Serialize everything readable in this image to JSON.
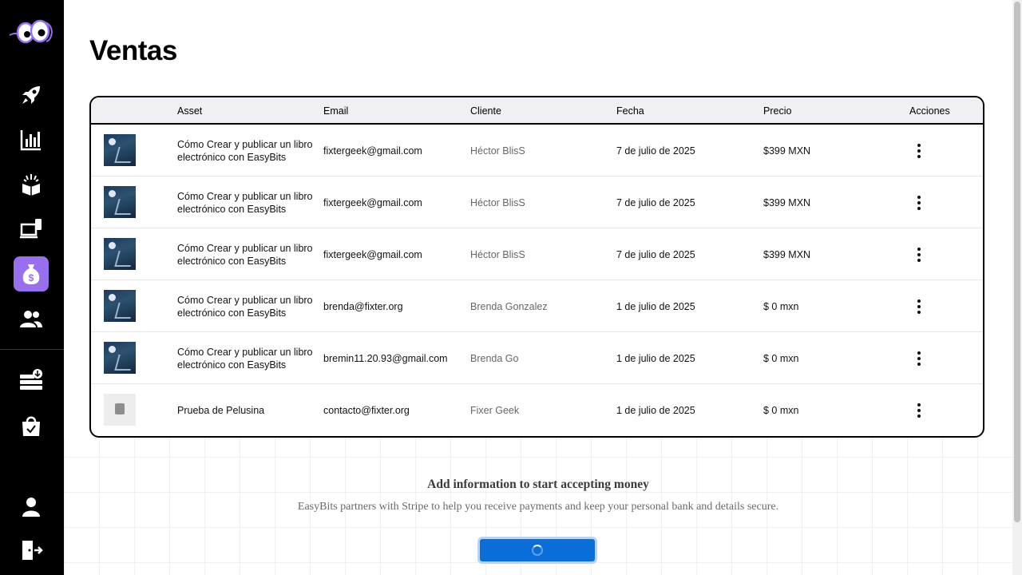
{
  "page": {
    "title": "Ventas"
  },
  "sidebar": {
    "active": "sales",
    "accent_color": "#9870ED",
    "items": [
      {
        "name": "rocket-icon"
      },
      {
        "name": "stats-chart-icon"
      },
      {
        "name": "gift-box-icon"
      },
      {
        "name": "laptop-device-icon"
      },
      {
        "name": "money-bag-icon"
      },
      {
        "name": "users-icon"
      },
      {
        "name": "database-download-icon"
      },
      {
        "name": "shopping-bag-icon"
      },
      {
        "name": "user-profile-icon"
      },
      {
        "name": "logout-icon"
      }
    ]
  },
  "table": {
    "headers": {
      "asset": "Asset",
      "email": "Email",
      "client": "Cliente",
      "date": "Fecha",
      "price": "Precio",
      "actions": "Acciones"
    },
    "rows": [
      {
        "asset": "Cómo Crear y publicar un libro electrónico con EasyBits",
        "email": "fixtergeek@gmail.com",
        "client": "Héctor BlisS",
        "date": "7 de julio de 2025",
        "price": "$399 MXN"
      },
      {
        "asset": "Cómo Crear y publicar un libro electrónico con EasyBits",
        "email": "fixtergeek@gmail.com",
        "client": "Héctor BlisS",
        "date": "7 de julio de 2025",
        "price": "$399 MXN"
      },
      {
        "asset": "Cómo Crear y publicar un libro electrónico con EasyBits",
        "email": "fixtergeek@gmail.com",
        "client": "Héctor BlisS",
        "date": "7 de julio de 2025",
        "price": "$399 MXN"
      },
      {
        "asset": "Cómo Crear y publicar un libro electrónico con EasyBits",
        "email": "brenda@fixter.org",
        "client": "Brenda Gonzalez",
        "date": "1 de julio de 2025",
        "price": "$ 0 mxn"
      },
      {
        "asset": "Cómo Crear y publicar un libro electrónico con EasyBits",
        "email": "bremin11.20.93@gmail.com",
        "client": "Brenda Go",
        "date": "1 de julio de 2025",
        "price": "$ 0 mxn"
      },
      {
        "asset": "Prueba de Pelusina",
        "email": "contacto@fixter.org",
        "client": "Fixer Geek",
        "date": "1 de julio de 2025",
        "price": "$ 0 mxn"
      }
    ]
  },
  "stripe": {
    "title": "Add information to start accepting money",
    "description": "EasyBits partners with Stripe to help you receive payments and keep your personal bank and details secure.",
    "button_state": "loading",
    "button_color": "#0a6ed8"
  }
}
